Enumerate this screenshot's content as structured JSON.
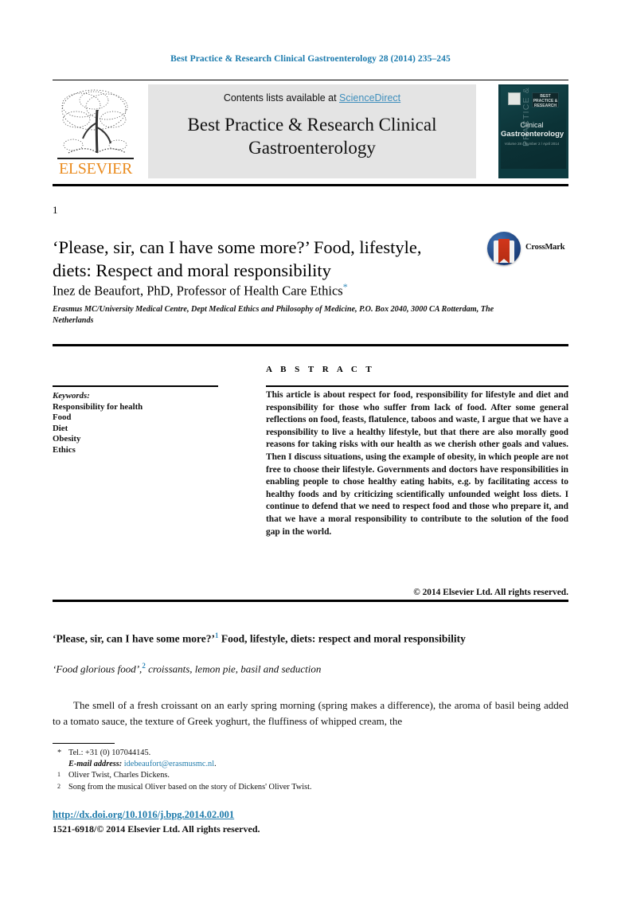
{
  "running_head": "Best Practice & Research Clinical Gastroenterology 28 (2014) 235–245",
  "header": {
    "elsevier_logo_text": "ELSEVIER",
    "tree_icon": "elsevier-tree-icon",
    "contents_prefix": "Contents lists available at ",
    "sciencedirect_link": "ScienceDirect",
    "journal_title": "Best Practice & Research Clinical Gastroenterology",
    "cover": {
      "vertical_text": "PRACTICE & RESEARCH",
      "best_badge": "BEST PRACTICE & RESEARCH",
      "name_line1": "Clinical",
      "name_line2": "Gastroenterology",
      "sub_text": "Volume 28 / Number 2 / April 2014"
    }
  },
  "article": {
    "number": "1",
    "title": "‘Please, sir, can I have some more?’ Food, lifestyle, diets: Respect and moral responsibility",
    "crossmark_label": "CrossMark",
    "crossmark_icon": "crossmark-icon",
    "author": "Inez de Beaufort, PhD, Professor of Health Care Ethics",
    "author_marker": "*",
    "affiliation": "Erasmus MC/University Medical Centre, Dept Medical Ethics and Philosophy of Medicine, P.O. Box 2040, 3000 CA Rotterdam, The Netherlands"
  },
  "keywords": {
    "heading": "Keywords:",
    "items": [
      "Responsibility for health",
      "Food",
      "Diet",
      "Obesity",
      "Ethics"
    ]
  },
  "abstract": {
    "heading": "A B S T R A C T",
    "body": "This article is about respect for food, responsibility for lifestyle and diet and responsibility for those who suffer from lack of food. After some general reflections on food, feasts, flatulence, taboos and waste, I argue that we have a responsibility to live a healthy lifestyle, but that there are also morally good reasons for taking risks with our health as we cherish other goals and values. Then I discuss situations, using the example of obesity, in which people are not free to choose their lifestyle. Governments and doctors have responsibilities in enabling people to chose healthy eating habits, e.g. by facilitating access to healthy foods and by criticizing scientifically unfounded weight loss diets. I continue to defend that we need to respect food and those who prepare it, and that we have a moral responsibility to contribute to the solution of the food gap in the world.",
    "copyright": "© 2014 Elsevier Ltd. All rights reserved."
  },
  "body": {
    "heading1_text": "‘Please, sir, can I have some more?’",
    "heading1_note": "1",
    "heading1_rest": " Food, lifestyle, diets: respect and moral responsibility",
    "heading2_text": "‘Food glorious food’,",
    "heading2_note": "2",
    "heading2_rest": " croissants, lemon pie, basil and seduction",
    "paragraph": "The smell of a fresh croissant on an early spring morning (spring makes a difference), the aroma of basil being added to a tomato sauce, the texture of Greek yoghurt, the fluffiness of whipped cream, the"
  },
  "footnotes": {
    "tel_marker": "*",
    "tel": "Tel.: +31 (0) 107044145.",
    "email_label": "E-mail address:",
    "email": "idebeaufort@erasmusmc.nl",
    "email_trail": ".",
    "note1_marker": "1",
    "note1": "Oliver Twist, Charles Dickens.",
    "note2_marker": "2",
    "note2": "Song from the musical Oliver based on the story of Dickens' Oliver Twist."
  },
  "footer": {
    "doi": "http://dx.doi.org/10.1016/j.bpg.2014.02.001",
    "issn_line": "1521-6918/© 2014 Elsevier Ltd. All rights reserved."
  },
  "colors": {
    "link_blue": "#1f7bab",
    "sciencedirect_blue": "#3e8ebc",
    "elsevier_orange": "#ea8b1e",
    "banner_grey": "#e4e4e4",
    "cover_teal": "#0d3b40"
  }
}
